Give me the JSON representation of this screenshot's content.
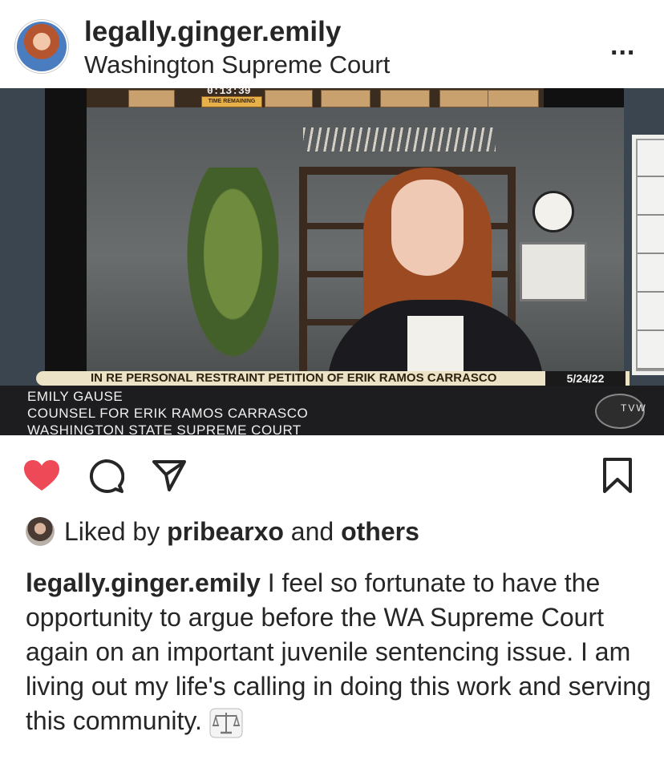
{
  "header": {
    "username": "legally.ginger.emily",
    "location": "Washington Supreme Court",
    "more_label": "..."
  },
  "video": {
    "timer": "0:13:39",
    "remaining_label": "TIME REMAINING",
    "case_title": "IN RE PERSONAL RESTRAINT PETITION OF ERIK RAMOS CARRASCO",
    "date": "5/24/22",
    "speaker_name": "EMILY GAUSE",
    "speaker_role": "COUNSEL FOR ERIK RAMOS CARRASCO",
    "court": "WASHINGTON STATE SUPREME COURT",
    "network_logo": "TVW"
  },
  "actions": {
    "like_icon": "heart-icon",
    "like_color": "#ed4956",
    "comment_icon": "comment-icon",
    "share_icon": "share-icon",
    "save_icon": "save-icon"
  },
  "likes": {
    "prefix": "Liked by",
    "liker": "pribearxo",
    "joiner": "and",
    "others": "others"
  },
  "caption": {
    "username": "legally.ginger.emily",
    "text": " I feel so fortunate to have the opportunity to argue before the WA Supreme Court again on an important juvenile sentencing issue.  I am living out my life's calling in doing this work and serving this community. ",
    "emoji_icon": "scales-icon"
  }
}
